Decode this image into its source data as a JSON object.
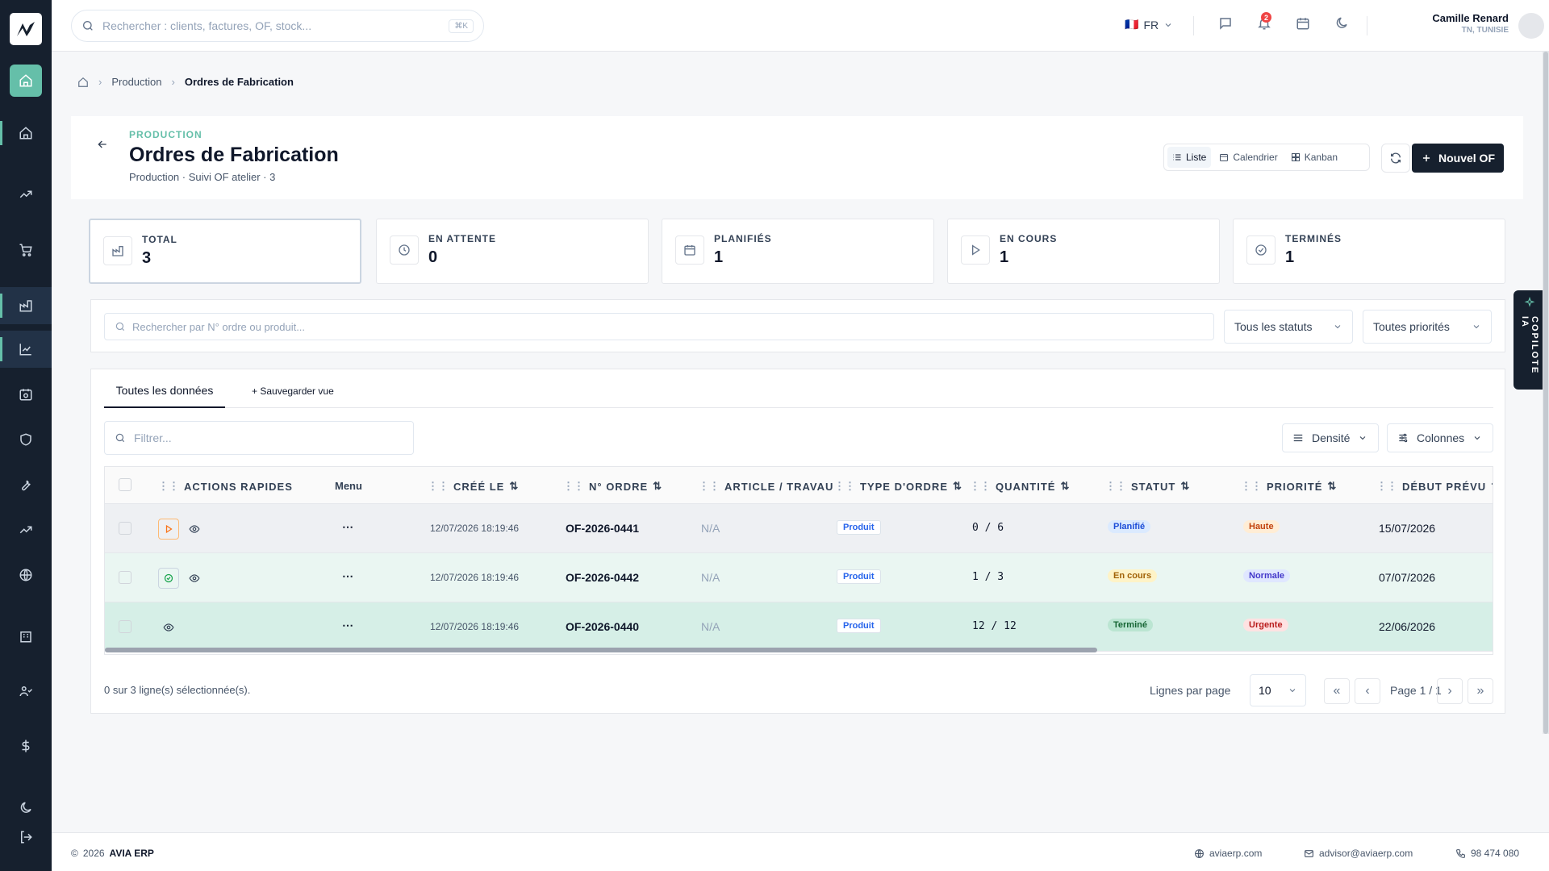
{
  "topbar": {
    "search_placeholder": "Rechercher : clients, factures, OF, stock...",
    "search_shortcut": "⌘K",
    "lang_flag": "🇫🇷",
    "lang": "FR",
    "notif_count": "2",
    "user_name": "Camille Renard",
    "user_location": "TN, TUNISIE"
  },
  "breadcrumb": {
    "level1": "Production",
    "current": "Ordres de Fabrication"
  },
  "header": {
    "eyebrow": "PRODUCTION",
    "title": "Ordres de Fabrication",
    "subtitle": "Production · Suivi OF atelier · 3",
    "view_list": "Liste",
    "view_calendar": "Calendrier",
    "view_kanban": "Kanban",
    "new_button": "Nouvel OF"
  },
  "kpis": [
    {
      "label": "TOTAL",
      "value": "3",
      "icon": "folder-icon"
    },
    {
      "label": "EN ATTENTE",
      "value": "0",
      "icon": "clock-icon"
    },
    {
      "label": "PLANIFIÉS",
      "value": "1",
      "icon": "calendar-icon"
    },
    {
      "label": "EN COURS",
      "value": "1",
      "icon": "play-icon"
    },
    {
      "label": "TERMINÉS",
      "value": "1",
      "icon": "check-circle-icon"
    }
  ],
  "filters": {
    "search_placeholder": "Rechercher par N° ordre ou produit...",
    "status": "Tous les statuts",
    "priority": "Toutes priorités"
  },
  "copilot": {
    "label": "COPILOTE IA"
  },
  "tabs": {
    "all": "Toutes les données",
    "save_view": "+ Sauvegarder vue"
  },
  "table_tools": {
    "filter_placeholder": "Filtrer...",
    "density": "Densité",
    "columns": "Colonnes"
  },
  "table": {
    "headers": {
      "actions": "ACTIONS RAPIDES",
      "menu": "Menu",
      "created": "CRÉÉ LE",
      "order_no": "N° ORDRE",
      "article": "ARTICLE / TRAVAU",
      "type": "TYPE D'ORDRE",
      "quantity": "QUANTITÉ",
      "status": "STATUT",
      "priority": "PRIORITÉ",
      "start": "DÉBUT PRÉVU"
    },
    "rows": [
      {
        "created": "12/07/2026 18:19:46",
        "order_no": "OF-2026-0441",
        "article": "N/A",
        "type": "Produit",
        "quantity": "0 / 6",
        "status": "Planifié",
        "priority": "Haute",
        "start": "15/07/2026",
        "action_icon": "play-icon"
      },
      {
        "created": "12/07/2026 18:19:46",
        "order_no": "OF-2026-0442",
        "article": "N/A",
        "type": "Produit",
        "quantity": "1 / 3",
        "status": "En cours",
        "priority": "Normale",
        "start": "07/07/2026",
        "action_icon": "check-circle-icon"
      },
      {
        "created": "12/07/2026 18:19:46",
        "order_no": "OF-2026-0440",
        "article": "N/A",
        "type": "Produit",
        "quantity": "12 / 12",
        "status": "Terminé",
        "priority": "Urgente",
        "start": "22/06/2026",
        "action_icon": "eye-icon"
      }
    ]
  },
  "pagination": {
    "selected_text": "0 sur 3 ligne(s) sélectionnée(s).",
    "rows_per_page_label": "Lignes par page",
    "rows_per_page": "10",
    "page_text": "Page 1 / 1"
  },
  "footer": {
    "copyright": "2026",
    "brand": "AVIA ERP",
    "site": "aviaerp.com",
    "email": "advisor@aviaerp.com",
    "phone": "98 474 080"
  }
}
